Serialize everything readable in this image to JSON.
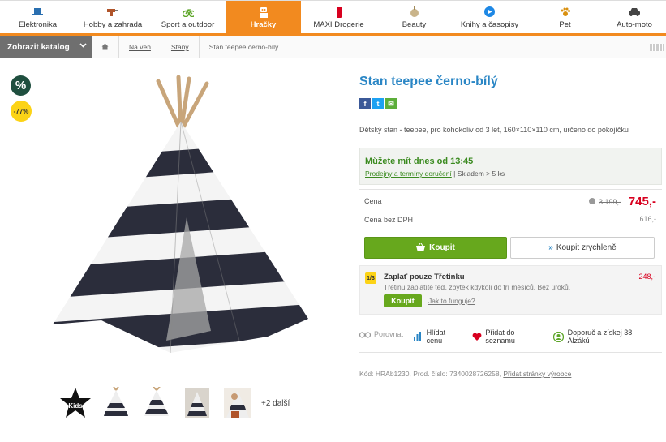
{
  "nav": {
    "items": [
      {
        "label": "Elektronika",
        "icon": "laptop-icon"
      },
      {
        "label": "Hobby a zahrada",
        "icon": "drill-icon"
      },
      {
        "label": "Sport a outdoor",
        "icon": "bicycle-icon"
      },
      {
        "label": "Hračky",
        "icon": "robot-icon"
      },
      {
        "label": "MAXI Drogerie",
        "icon": "spray-bottle-icon"
      },
      {
        "label": "Beauty",
        "icon": "cosmetics-icon"
      },
      {
        "label": "Knihy a časopisy",
        "icon": "play-icon"
      },
      {
        "label": "Pet",
        "icon": "paw-icon"
      },
      {
        "label": "Auto-moto",
        "icon": "car-icon"
      }
    ],
    "active_index": 3,
    "accent": "#f28a1f"
  },
  "catalog_button": "Zobrazit katalog",
  "breadcrumb": {
    "items": [
      "Na ven",
      "Stany"
    ],
    "current": "Stan teepee černo-bílý"
  },
  "badges": {
    "percent_symbol": "%",
    "discount": "-77%"
  },
  "thumbnails": {
    "more": "+2 další",
    "kids_label": "Kids"
  },
  "product": {
    "title": "Stan teepee černo-bílý",
    "description": "Dětský stan - teepee, pro kohokoliv od 3 let, 160×110×110 cm, určeno do pokojíčku",
    "availability": {
      "headline": "Můžete mít dnes od 13:45",
      "link": "Prodejny a termíny doručení",
      "separator": " | ",
      "stock": "Skladem > 5 ks"
    },
    "price": {
      "label": "Cena",
      "old": "3 199,-",
      "new": "745,-",
      "no_vat_label": "Cena bez DPH",
      "no_vat": "616,-"
    },
    "buy_button": "Koupit",
    "fast_buy_button": "Koupit zrychleně",
    "third": {
      "badge": "1/3",
      "title": "Zaplať pouze Třetinku",
      "amount": "248,-",
      "text": "Třetinu zaplatíte teď, zbytek kdykoli do tří měsíců. Bez úroků.",
      "button": "Koupit",
      "link": "Jak to funguje?"
    },
    "actions": [
      {
        "label": "Porovnat",
        "icon": "compare-icon"
      },
      {
        "label": "Hlídat cenu",
        "icon": "price-watch-icon"
      },
      {
        "label": "Přidat do seznamu",
        "icon": "heart-icon"
      },
      {
        "label": "Doporuč a získej 38 Alzáků",
        "icon": "recommend-icon"
      }
    ],
    "codes": {
      "code_label": "Kód:",
      "code": "HRAb1230,",
      "prod_label": "Prod. číslo:",
      "prod": "7340028726258,",
      "link": "Přidat stránky výrobce"
    }
  }
}
